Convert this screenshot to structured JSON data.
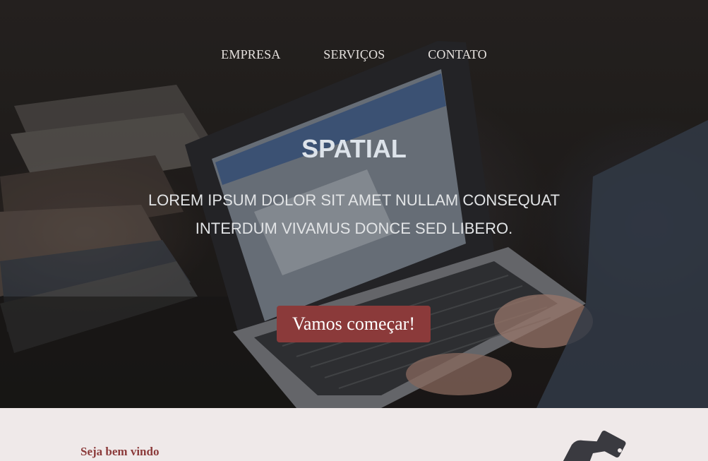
{
  "nav": {
    "items": [
      {
        "label": "EMPRESA"
      },
      {
        "label": "SERVIÇOS"
      },
      {
        "label": "CONTATO"
      }
    ]
  },
  "hero": {
    "title": "SPATIAL",
    "subtitle": "LOREM IPSUM DOLOR SIT AMET NULLAM CONSEQUAT INTERDUM VIVAMUS DONCE SED LIBERO.",
    "cta_label": "Vamos começar!"
  },
  "welcome": {
    "heading": "Seja bem vindo",
    "icon": "hand-holding-phone-icon"
  },
  "colors": {
    "accent": "#8b3a3a",
    "welcome_bg": "#efe9e9",
    "hero_text": "#dde3ea"
  }
}
